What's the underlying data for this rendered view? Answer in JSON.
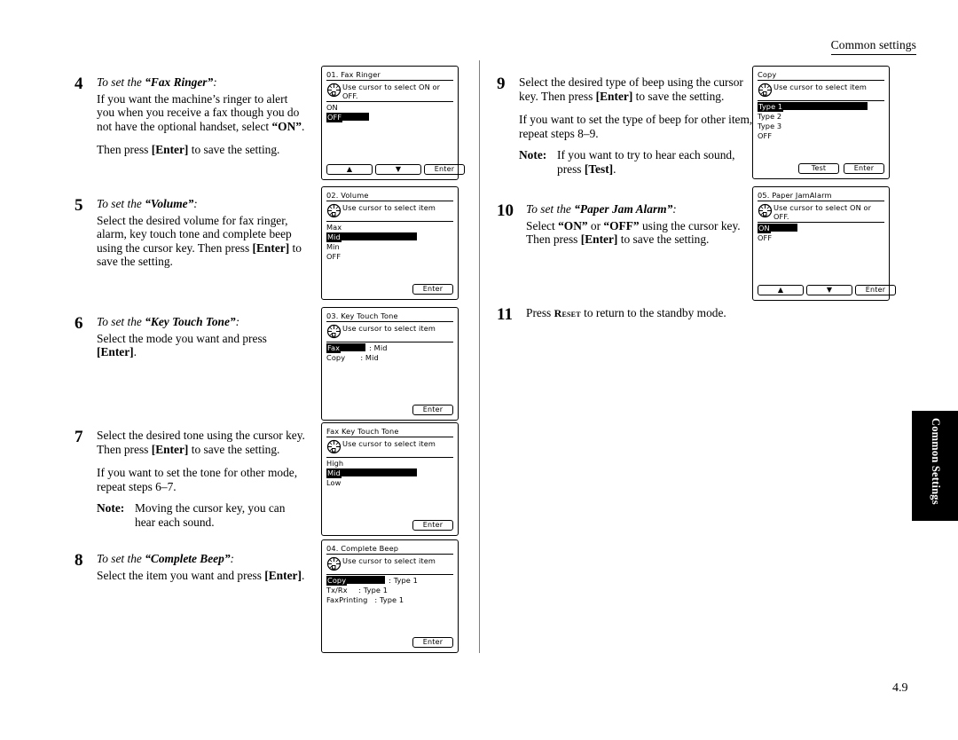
{
  "header": {
    "title": "Common settings"
  },
  "side_tab": {
    "label": "Common Settings"
  },
  "folio": {
    "page": "4.9"
  },
  "steps": [
    {
      "num": "4",
      "title_lead": "To set the ",
      "title_quoted": "“Fax Ringer”",
      "title_tail": ":",
      "paras": [
        "If you want the machine’s ringer to alert you when you receive a fax though you do not have the optional handset, select “ON”.",
        "Then press [Enter] to save the setting."
      ]
    },
    {
      "num": "5",
      "title_lead": "To set the ",
      "title_quoted": "“Volume”",
      "title_tail": ":",
      "paras": [
        "Select the desired volume for fax ringer, alarm, key touch tone and complete beep using the cursor key. Then press [Enter] to save the setting."
      ]
    },
    {
      "num": "6",
      "title_lead": "To set the ",
      "title_quoted": "“Key Touch Tone”",
      "title_tail": ":",
      "paras": [
        "Select the mode you want and press [Enter]."
      ]
    },
    {
      "num": "7",
      "paras": [
        "Select the desired tone using the cursor key. Then press [Enter] to save the setting.",
        "If you want to set the tone for other mode, repeat steps 6–7."
      ],
      "note_label": "Note:",
      "note_text": "Moving the cursor key, you can hear each sound."
    },
    {
      "num": "8",
      "title_lead": "To set the ",
      "title_quoted": "“Complete Beep”",
      "title_tail": ":",
      "paras": [
        "Select the item you want and press [Enter]."
      ]
    },
    {
      "num": "9",
      "paras": [
        "Select the desired type of beep using the cursor key. Then press [Enter] to save the setting.",
        "If you want to set the type of beep for other item, repeat steps 8–9."
      ],
      "note_label": "Note:",
      "note_text": "If you want to try to hear each sound, press [Test]."
    },
    {
      "num": "10",
      "title_lead": "To set the ",
      "title_quoted": "“Paper Jam Alarm”",
      "title_tail": ":",
      "paras": [
        "Select “ON” or “OFF” using the cursor key. Then press [Enter] to save the setting."
      ]
    },
    {
      "num": "11",
      "paras": [
        "Press RESET to return to the standby mode."
      ]
    }
  ],
  "lcd_panels": [
    {
      "id": "fax-ringer",
      "title": "01. Fax Ringer",
      "help": "Use cursor to select ON or OFF.",
      "rows": [
        {
          "text": "ON",
          "selected": false
        },
        {
          "text": "OFF",
          "selected": true,
          "bar": 30
        }
      ],
      "buttons": [
        "▲",
        "▼",
        "Enter"
      ],
      "button_layout": "spread"
    },
    {
      "id": "volume",
      "title": "02. Volume",
      "help": "Use cursor to select item",
      "rows": [
        {
          "text": "Max",
          "selected": false
        },
        {
          "text": "Mid",
          "selected": true,
          "bar": 85
        },
        {
          "text": "Min",
          "selected": false
        },
        {
          "text": "OFF",
          "selected": false
        }
      ],
      "buttons": [
        "Enter"
      ],
      "button_layout": "right"
    },
    {
      "id": "key-touch-tone",
      "title": "03. Key Touch Tone",
      "help": "Use cursor to select item",
      "rows": [
        {
          "text": "Fax",
          "selected": true,
          "bar": 28,
          "value": ": Mid"
        },
        {
          "text": "Copy",
          "selected": false,
          "value": ": Mid"
        }
      ],
      "buttons": [
        "Enter"
      ],
      "button_layout": "right"
    },
    {
      "id": "fax-key-touch-tone",
      "title": "Fax Key Touch Tone",
      "help": "Use cursor to select item",
      "rows": [
        {
          "text": "High",
          "selected": false
        },
        {
          "text": "Mid",
          "selected": true,
          "bar": 85
        },
        {
          "text": "Low",
          "selected": false
        }
      ],
      "buttons": [
        "Enter"
      ],
      "button_layout": "right"
    },
    {
      "id": "complete-beep",
      "title": "04. Complete Beep",
      "help": "Use cursor to select item",
      "rows": [
        {
          "text": "Copy",
          "selected": true,
          "bar": 43,
          "value": ": Type 1"
        },
        {
          "text": "Tx/Rx",
          "selected": false,
          "value": ": Type 1"
        },
        {
          "text": "FaxPrinting",
          "selected": false,
          "value": ": Type 1"
        }
      ],
      "buttons": [
        "Enter"
      ],
      "button_layout": "right"
    },
    {
      "id": "copy-beep-type",
      "title": "Copy",
      "help": "Use cursor to select item",
      "rows": [
        {
          "text": "Type 1",
          "selected": true,
          "bar": 95
        },
        {
          "text": "Type 2",
          "selected": false
        },
        {
          "text": "Type 3",
          "selected": false
        },
        {
          "text": "OFF",
          "selected": false
        }
      ],
      "buttons": [
        "Test",
        "Enter"
      ],
      "button_layout": "right"
    },
    {
      "id": "paper-jam-alarm",
      "title": "05. Paper JamAlarm",
      "help": "Use cursor to select ON or OFF.",
      "rows": [
        {
          "text": "ON",
          "selected": true,
          "bar": 30
        },
        {
          "text": "OFF",
          "selected": false
        }
      ],
      "buttons": [
        "▲",
        "▼",
        "Enter"
      ],
      "button_layout": "spread"
    }
  ]
}
